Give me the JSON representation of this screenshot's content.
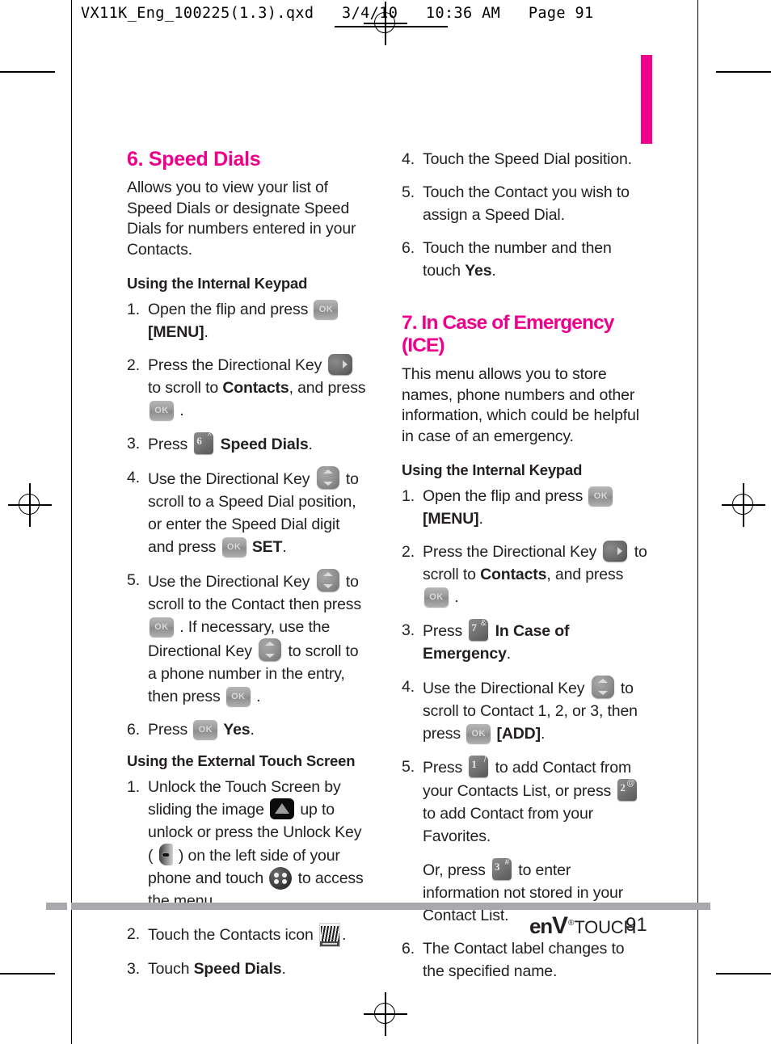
{
  "print_header": {
    "text": "VX11K_Eng_100225(1.3).qxd   3/4/10   10:36 AM   Page 91"
  },
  "accent_color": "#ec008c",
  "body_color": "#231f20",
  "left_column": {
    "section": {
      "heading": "6. Speed Dials",
      "intro": "Allows you to view your list of Speed Dials or designate Speed Dials for numbers entered in your Contacts."
    },
    "subhead_keypad": "Using the Internal Keypad",
    "keypad_steps": [
      {
        "num": "1.",
        "parts": [
          {
            "t": "text",
            "v": "Open the flip and press "
          },
          {
            "t": "key-ok"
          },
          {
            "t": "bold",
            "v": " [MENU]"
          },
          {
            "t": "text",
            "v": "."
          }
        ]
      },
      {
        "num": "2.",
        "parts": [
          {
            "t": "text",
            "v": "Press the Directional Key "
          },
          {
            "t": "key-dir-right"
          },
          {
            "t": "text",
            "v": " to scroll to "
          },
          {
            "t": "bold",
            "v": "Contacts"
          },
          {
            "t": "text",
            "v": ", and press "
          },
          {
            "t": "key-ok"
          },
          {
            "t": "text",
            "v": " ."
          }
        ]
      },
      {
        "num": "3.",
        "parts": [
          {
            "t": "text",
            "v": "Press "
          },
          {
            "t": "key-num",
            "digit": "6",
            "sup": "^"
          },
          {
            "t": "bold",
            "v": " Speed Dials"
          },
          {
            "t": "text",
            "v": "."
          }
        ]
      },
      {
        "num": "4.",
        "parts": [
          {
            "t": "text",
            "v": "Use the Directional Key "
          },
          {
            "t": "key-dir-ud"
          },
          {
            "t": "text",
            "v": " to scroll to a Speed Dial position, or enter the Speed Dial digit and press "
          },
          {
            "t": "key-ok"
          },
          {
            "t": "bold",
            "v": " SET"
          },
          {
            "t": "text",
            "v": "."
          }
        ]
      },
      {
        "num": "5.",
        "parts": [
          {
            "t": "text",
            "v": "Use the Directional Key "
          },
          {
            "t": "key-dir-ud"
          },
          {
            "t": "text",
            "v": " to scroll to the Contact then press "
          },
          {
            "t": "key-ok"
          },
          {
            "t": "text",
            "v": " .  If necessary, use the Directional Key "
          },
          {
            "t": "key-dir-ud"
          },
          {
            "t": "text",
            "v": " to scroll to a phone number in the entry, then press "
          },
          {
            "t": "key-ok"
          },
          {
            "t": "text",
            "v": " ."
          }
        ]
      },
      {
        "num": "6.",
        "parts": [
          {
            "t": "text",
            "v": "Press "
          },
          {
            "t": "key-ok"
          },
          {
            "t": "bold",
            "v": " Yes"
          },
          {
            "t": "text",
            "v": "."
          }
        ]
      }
    ],
    "subhead_touch": "Using the External Touch Screen",
    "touch_steps": [
      {
        "num": "1.",
        "parts": [
          {
            "t": "text",
            "v": "Unlock the Touch Screen by sliding the image "
          },
          {
            "t": "icon-slider-up"
          },
          {
            "t": "text",
            "v": " up to unlock or press the Unlock Key ( "
          },
          {
            "t": "icon-unlock-key"
          },
          {
            "t": "text",
            "v": " ) on the left side of your phone and touch "
          },
          {
            "t": "icon-menu-dots"
          },
          {
            "t": "text",
            "v": " to access the menu."
          }
        ]
      },
      {
        "num": "2.",
        "parts": [
          {
            "t": "text",
            "v": "Touch the Contacts icon "
          },
          {
            "t": "icon-contacts"
          },
          {
            "t": "text",
            "v": "."
          }
        ]
      },
      {
        "num": "3.",
        "parts": [
          {
            "t": "text",
            "v": "Touch "
          },
          {
            "t": "bold",
            "v": "Speed Dials"
          },
          {
            "t": "text",
            "v": "."
          }
        ]
      }
    ]
  },
  "right_column": {
    "touch_steps_continued": [
      {
        "num": "4.",
        "parts": [
          {
            "t": "text",
            "v": "Touch the Speed Dial position."
          }
        ]
      },
      {
        "num": "5.",
        "parts": [
          {
            "t": "text",
            "v": "Touch the Contact you wish to assign a Speed Dial."
          }
        ]
      },
      {
        "num": "6.",
        "parts": [
          {
            "t": "text",
            "v": "Touch the number and then touch "
          },
          {
            "t": "bold",
            "v": "Yes"
          },
          {
            "t": "text",
            "v": "."
          }
        ]
      }
    ],
    "section": {
      "heading": "7. In Case of Emergency (ICE)",
      "intro": "This menu allows you to store names, phone numbers and other information, which could be helpful in case of an emergency."
    },
    "subhead_keypad": "Using the Internal Keypad",
    "keypad_steps": [
      {
        "num": "1.",
        "parts": [
          {
            "t": "text",
            "v": "Open the flip and press "
          },
          {
            "t": "key-ok"
          },
          {
            "t": "bold",
            "v": " [MENU]"
          },
          {
            "t": "text",
            "v": "."
          }
        ]
      },
      {
        "num": "2.",
        "parts": [
          {
            "t": "text",
            "v": "Press the Directional Key "
          },
          {
            "t": "key-dir-right"
          },
          {
            "t": "text",
            "v": " to scroll to "
          },
          {
            "t": "bold",
            "v": "Contacts"
          },
          {
            "t": "text",
            "v": ", and press "
          },
          {
            "t": "key-ok"
          },
          {
            "t": "text",
            "v": " ."
          }
        ]
      },
      {
        "num": "3.",
        "parts": [
          {
            "t": "text",
            "v": "Press "
          },
          {
            "t": "key-num",
            "digit": "7",
            "sup": "&"
          },
          {
            "t": "bold",
            "v": " In Case of Emergency"
          },
          {
            "t": "text",
            "v": "."
          }
        ]
      },
      {
        "num": "4.",
        "parts": [
          {
            "t": "text",
            "v": "Use the Directional Key "
          },
          {
            "t": "key-dir-ud"
          },
          {
            "t": "text",
            "v": " to scroll to Contact 1, 2, or 3, then press "
          },
          {
            "t": "key-ok"
          },
          {
            "t": "bold",
            "v": " [ADD]"
          },
          {
            "t": "text",
            "v": "."
          }
        ]
      },
      {
        "num": "5.",
        "parts": [
          {
            "t": "text",
            "v": "Press "
          },
          {
            "t": "key-num",
            "digit": "1",
            "sup": "/"
          },
          {
            "t": "text",
            "v": " to add Contact from your Contacts List, or press "
          },
          {
            "t": "key-num",
            "digit": "2",
            "sup": "@"
          },
          {
            "t": "text",
            "v": " to add Contact from your Favorites."
          }
        ],
        "sub_parts": [
          {
            "t": "text",
            "v": "Or, press "
          },
          {
            "t": "key-num",
            "digit": "3",
            "sup": "#"
          },
          {
            "t": "text",
            "v": " to enter information not stored in your Contact List."
          }
        ]
      },
      {
        "num": "6.",
        "parts": [
          {
            "t": "text",
            "v": "The Contact label changes to the specified name."
          }
        ]
      }
    ]
  },
  "footer": {
    "brand_en": "en",
    "brand_v": "V",
    "brand_reg": "®",
    "brand_touch": "TOUCH",
    "page_number": "91"
  }
}
